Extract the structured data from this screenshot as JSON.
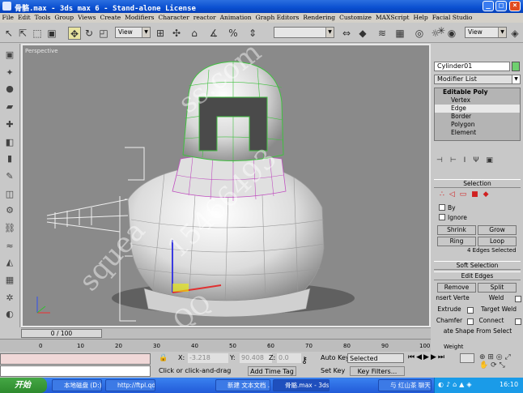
{
  "window": {
    "title": "骨骼.max - 3ds max 6 - Stand-alone License",
    "controls": [
      "_",
      "□",
      "×"
    ]
  },
  "menu": [
    "File",
    "Edit",
    "Tools",
    "Group",
    "Views",
    "Create",
    "Modifiers",
    "Character",
    "reactor",
    "Animation",
    "Graph Editors",
    "Rendering",
    "Customize",
    "MAXScript",
    "Help",
    "Facial Studio"
  ],
  "toolbar": {
    "view_dropdown_1": "View",
    "view_dropdown_2": "View"
  },
  "viewport": {
    "label": "Perspective"
  },
  "command_panel": {
    "object_name": "Cylinder01",
    "object_color": "#6fd06f",
    "modifier_list": "Modifier List",
    "stack": {
      "head": "Editable Poly",
      "items": [
        "Vertex",
        "Edge",
        "Border",
        "Polygon",
        "Element"
      ],
      "selected": "Edge"
    },
    "selection": {
      "title": "Selection",
      "by_label": "By",
      "ignore_label": "Ignore",
      "shrink": "Shrink",
      "grow": "Grow",
      "ring": "Ring",
      "loop": "Loop",
      "status": "4 Edges Selected"
    },
    "soft_selection": "Soft Selection",
    "edit_edges": {
      "title": "Edit Edges",
      "remove": "Remove",
      "split": "Split",
      "insert_vertex": "nsert Verte",
      "weld": "Weld",
      "extrude": "Extrude",
      "target_weld": "Target Weld",
      "chamfer": "Chamfer",
      "connect": "Connect",
      "create_shape": "ate Shape From Select",
      "weight": "Weight"
    }
  },
  "timeline": {
    "slider": "0 / 100",
    "ticks": [
      "0",
      "10",
      "20",
      "30",
      "40",
      "50",
      "60",
      "70",
      "80",
      "90",
      "100"
    ]
  },
  "status": {
    "x_label": "X:",
    "x_value": "-3.218",
    "y_label": "Y:",
    "y_value": "90.408",
    "z_label": "Z:",
    "z_value": "0.0",
    "prompt": "Click or click-and-drag",
    "add_time_tag": "Add Time Tag",
    "auto_key": "Auto Key",
    "selected": "Selected",
    "set_key": "Set Key",
    "key_filters": "Key Filters..."
  },
  "taskbar": {
    "start": "开始",
    "tasks": [
      "本地磁盘 (D:)",
      "http://ftpl.qdc...",
      "新建 文本文档 ...",
      "骨骼.max - 3ds...",
      "与 红山茶 聊天中"
    ],
    "clock": "16:10"
  },
  "watermark": {
    "line1": "ss.com",
    "line2": "squea",
    "line3": "15466493",
    "line4": "QQ"
  }
}
